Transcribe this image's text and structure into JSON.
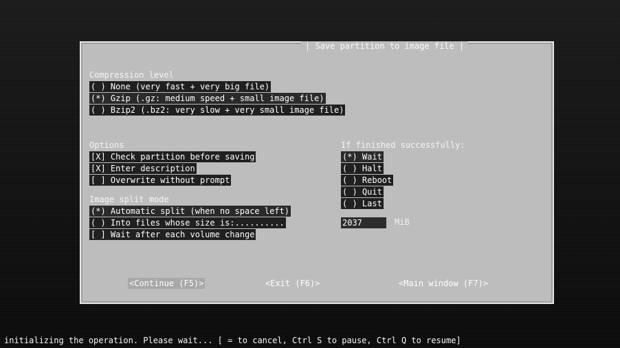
{
  "dialog": {
    "title": "| Save partition to image file |"
  },
  "compression": {
    "heading": "Compression level",
    "options": [
      "( ) None (very fast + very big file)",
      "(*) Gzip (.gz: medium speed + small image file)",
      "( ) Bzip2 (.bz2: very slow + very small image file)"
    ]
  },
  "options": {
    "heading": "Options",
    "items": [
      "[X] Check partition before saving",
      "[X] Enter description",
      "[ ] Overwrite without prompt"
    ]
  },
  "finished": {
    "heading": "If finished successfully:",
    "items": [
      "(*) Wait",
      "( ) Halt",
      "( ) Reboot",
      "( ) Quit",
      "( ) Last"
    ]
  },
  "split": {
    "heading": "Image split mode",
    "items": [
      "(*) Automatic split (when no space left)",
      "( ) Into files whose size is:..........",
      "[ ] Wait after each volume change"
    ],
    "size_value": "2037",
    "unit": "MiB"
  },
  "buttons": {
    "continue": "<Continue (F5)>",
    "exit": "<Exit (F6)>",
    "main_window": "<Main window (F7)>"
  },
  "status_bar": "initializing the operation. Please wait... [ = to cancel, Ctrl S to pause, Ctrl Q to resume]"
}
